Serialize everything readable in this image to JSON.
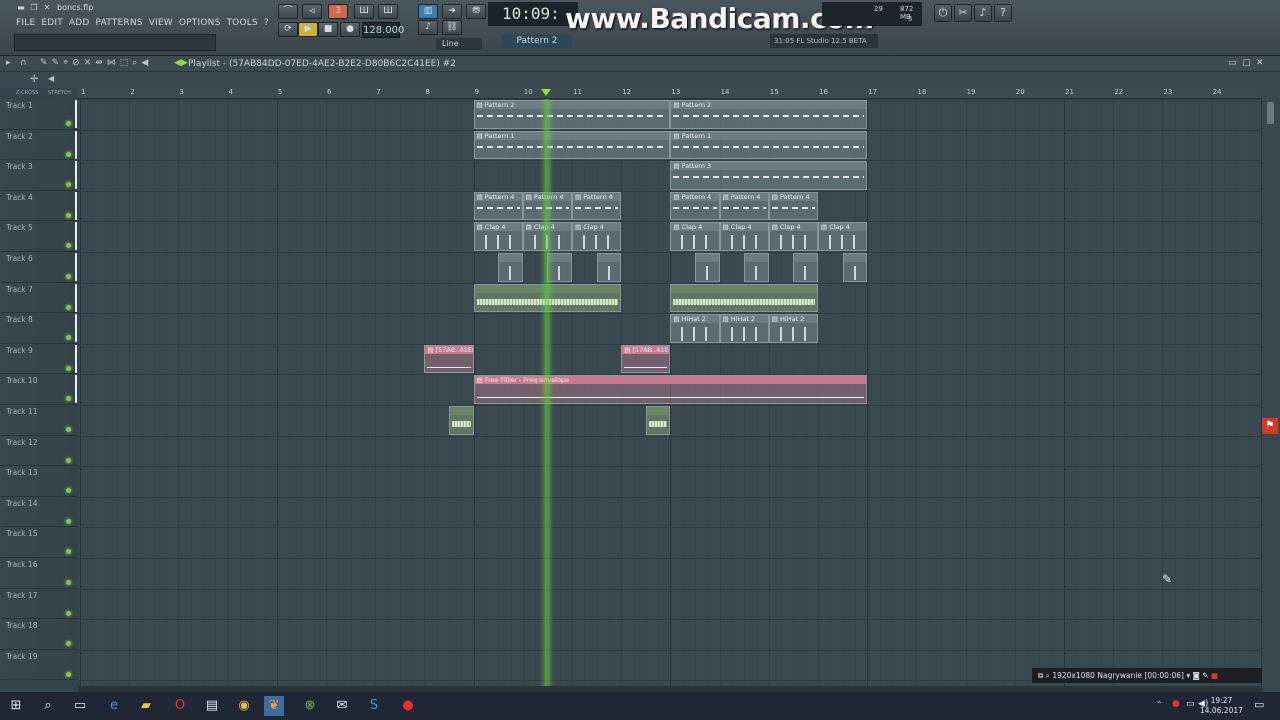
{
  "window": {
    "file_name": "boncs.flp"
  },
  "menu": [
    "FILE",
    "EDIT",
    "ADD",
    "PATTERNS",
    "VIEW",
    "OPTIONS",
    "TOOLS",
    "?"
  ],
  "transport": {
    "tempo": "128.000",
    "time": "10:09:",
    "pattern": "Pattern 2",
    "snap_mode": "Line"
  },
  "watermark": "www.Bandicam.com",
  "hint": "31:05  FL Studio 12.5 BETA",
  "cpu": {
    "val1": "29",
    "mem": "872 MB",
    "poly": "5"
  },
  "playlist": {
    "title": "Playlist - (57AB84DD-07ED-4AE2-B2E2-D80B6C2C41EE) #2",
    "snap_label": "Z-CROSS",
    "stretch_label": "STRETCH"
  },
  "bars": [
    "1",
    "2",
    "3",
    "4",
    "5",
    "6",
    "7",
    "8",
    "9",
    "10",
    "11",
    "12",
    "13",
    "14",
    "15",
    "16",
    "17",
    "18",
    "19",
    "20",
    "21",
    "22",
    "23",
    "24"
  ],
  "tracks": [
    "Track 1",
    "Track 2",
    "Track 3",
    "Track 4",
    "Track 5",
    "Track 6",
    "Track 7",
    "Track 8",
    "Track 9",
    "Track 10",
    "Track 11",
    "Track 12",
    "Track 13",
    "Track 14",
    "Track 15",
    "Track 16",
    "Track 17",
    "Track 18",
    "Track 19"
  ],
  "clips": [
    {
      "label": "Pattern 2",
      "track": 0,
      "start": 9,
      "end": 13,
      "kind": "pattern"
    },
    {
      "label": "Pattern 2",
      "track": 0,
      "start": 13,
      "end": 17,
      "kind": "pattern"
    },
    {
      "label": "Pattern 1",
      "track": 1,
      "start": 9,
      "end": 13,
      "kind": "pattern"
    },
    {
      "label": "Pattern 1",
      "track": 1,
      "start": 13,
      "end": 17,
      "kind": "pattern"
    },
    {
      "label": "Pattern 3",
      "track": 2,
      "start": 13,
      "end": 17,
      "kind": "pattern"
    },
    {
      "label": "Pattern 4",
      "track": 3,
      "start": 9,
      "end": 10,
      "kind": "pattern"
    },
    {
      "label": "Pattern 4",
      "track": 3,
      "start": 10,
      "end": 11,
      "kind": "pattern"
    },
    {
      "label": "Pattern 4",
      "track": 3,
      "start": 11,
      "end": 12,
      "kind": "pattern"
    },
    {
      "label": "Pattern 4",
      "track": 3,
      "start": 13,
      "end": 14,
      "kind": "pattern"
    },
    {
      "label": "Pattern 4",
      "track": 3,
      "start": 14,
      "end": 15,
      "kind": "pattern"
    },
    {
      "label": "Pattern 4",
      "track": 3,
      "start": 15,
      "end": 16,
      "kind": "pattern"
    },
    {
      "label": "Clap 4",
      "track": 4,
      "start": 9,
      "end": 10,
      "kind": "audio"
    },
    {
      "label": "Clap 4",
      "track": 4,
      "start": 10,
      "end": 11,
      "kind": "audio"
    },
    {
      "label": "Clap 4",
      "track": 4,
      "start": 11,
      "end": 12,
      "kind": "audio"
    },
    {
      "label": "Clap 4",
      "track": 4,
      "start": 13,
      "end": 14,
      "kind": "audio"
    },
    {
      "label": "Clap 4",
      "track": 4,
      "start": 14,
      "end": 15,
      "kind": "audio"
    },
    {
      "label": "Clap 4",
      "track": 4,
      "start": 15,
      "end": 16,
      "kind": "audio"
    },
    {
      "label": "Clap 4",
      "track": 4,
      "start": 16,
      "end": 17,
      "kind": "audio"
    },
    {
      "label": "",
      "track": 5,
      "start": 9.5,
      "end": 10,
      "kind": "audio"
    },
    {
      "label": "",
      "track": 5,
      "start": 10.5,
      "end": 11,
      "kind": "audio"
    },
    {
      "label": "",
      "track": 5,
      "start": 11.5,
      "end": 12,
      "kind": "audio"
    },
    {
      "label": "",
      "track": 5,
      "start": 13.5,
      "end": 14,
      "kind": "audio"
    },
    {
      "label": "",
      "track": 5,
      "start": 14.5,
      "end": 15,
      "kind": "audio"
    },
    {
      "label": "",
      "track": 5,
      "start": 15.5,
      "end": 16,
      "kind": "audio"
    },
    {
      "label": "",
      "track": 5,
      "start": 16.5,
      "end": 17,
      "kind": "audio"
    },
    {
      "label": "",
      "track": 6,
      "start": 9,
      "end": 12,
      "kind": "green"
    },
    {
      "label": "",
      "track": 6,
      "start": 13,
      "end": 16,
      "kind": "green"
    },
    {
      "label": "HiHat 2",
      "track": 7,
      "start": 13,
      "end": 14,
      "kind": "audio"
    },
    {
      "label": "HiHat 2",
      "track": 7,
      "start": 14,
      "end": 15,
      "kind": "audio"
    },
    {
      "label": "HiHat 2",
      "track": 7,
      "start": 15,
      "end": 16,
      "kind": "audio"
    },
    {
      "label": "[57AB..41EE]",
      "track": 8,
      "start": 8,
      "end": 9,
      "kind": "pink"
    },
    {
      "label": "[57AB..41EE]",
      "track": 8,
      "start": 12,
      "end": 13,
      "kind": "pink"
    },
    {
      "label": "Free Filter - Freq envelope",
      "track": 9,
      "start": 9,
      "end": 17,
      "kind": "pink"
    },
    {
      "label": "",
      "track": 10,
      "start": 8.5,
      "end": 9,
      "kind": "green"
    },
    {
      "label": "",
      "track": 10,
      "start": 12.5,
      "end": 13,
      "kind": "green"
    }
  ],
  "playhead_bar": 10.45,
  "recorder": {
    "resolution": "1920x1080",
    "status": "Nagrywanie [00:00:06]"
  },
  "tray": {
    "time": "19:27",
    "date": "14.06.2017"
  },
  "taskbar_apps": [
    "start-icon",
    "search-icon",
    "task-view-icon",
    "edge-icon",
    "explorer-icon",
    "opera-icon",
    "store-icon",
    "chrome-icon",
    "fl-studio-icon",
    "xbox-icon",
    "mail-icon",
    "skype-icon",
    "bandicam-icon"
  ]
}
